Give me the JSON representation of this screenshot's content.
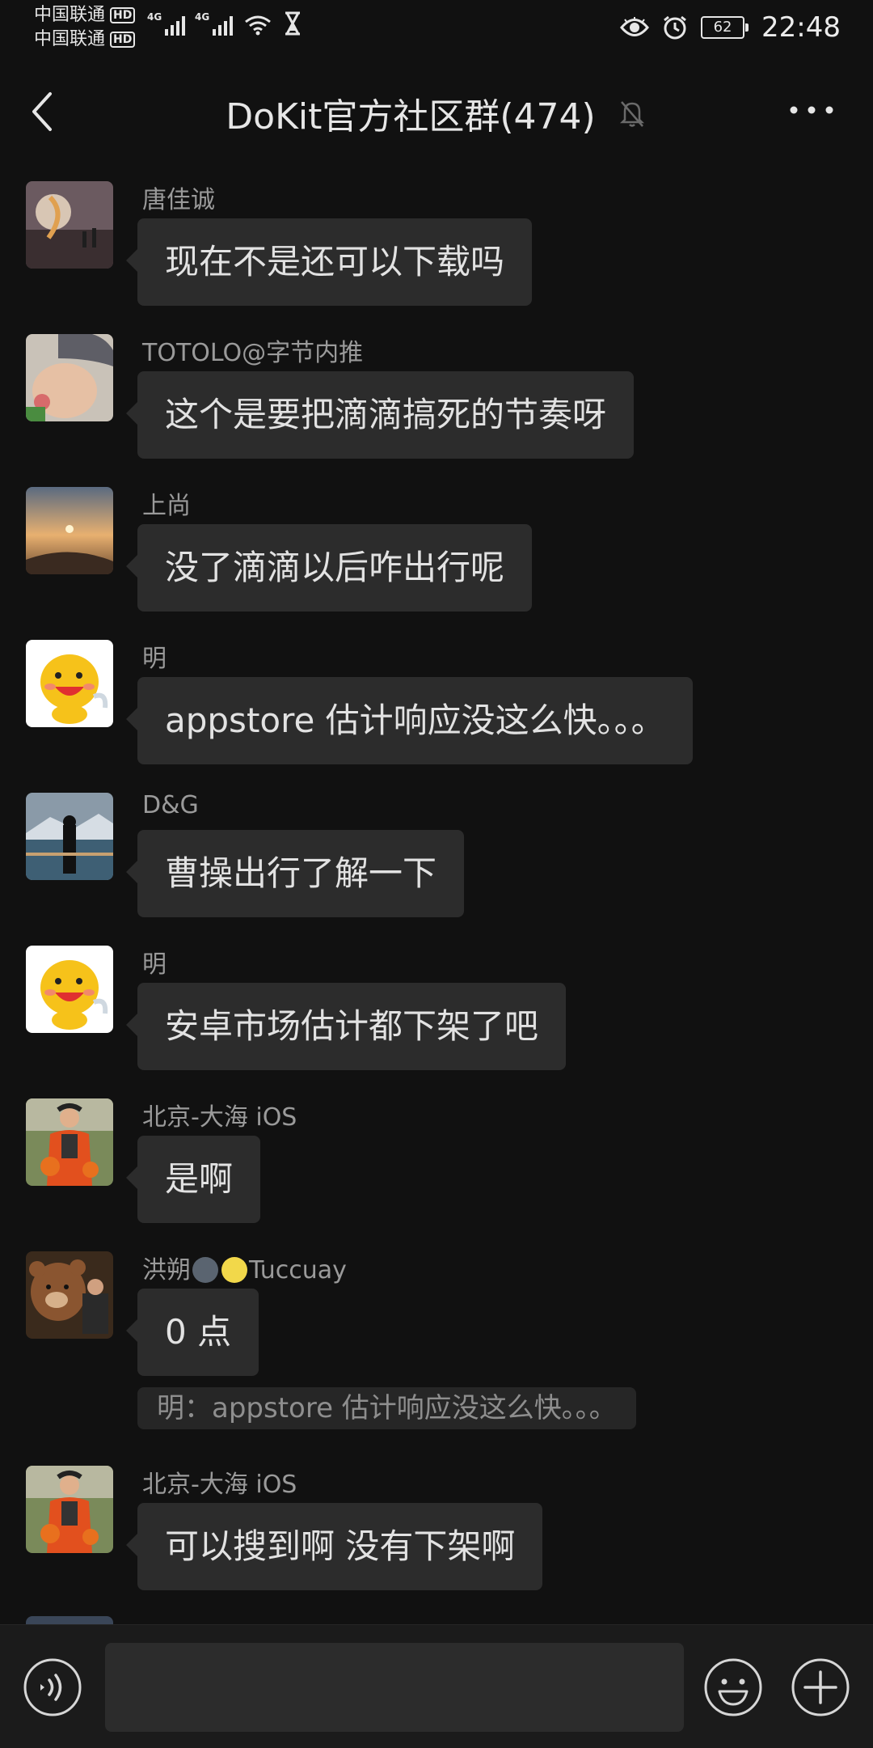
{
  "status_bar": {
    "carrier1": "中国联通",
    "carrier2": "中国联通",
    "hd": "HD",
    "network1": "4G",
    "network2": "4G",
    "battery": "62",
    "time": "22:48"
  },
  "header": {
    "back_icon": "chevron-left-icon",
    "title": "DoKit官方社区群(474)",
    "mute_icon": "bell-off-icon",
    "more_icon": "more-horizontal-icon"
  },
  "messages": [
    {
      "sender": "唐佳诚",
      "text": "现在不是还可以下载吗"
    },
    {
      "sender": "TOTOLO@字节内推",
      "text": "这个是要把滴滴搞死的节奏呀"
    },
    {
      "sender": "上尚",
      "text": "没了滴滴以后咋出行呢"
    },
    {
      "sender": "明",
      "text": "appstore 估计响应没这么快。。。"
    },
    {
      "sender": "D&G",
      "text": "曹操出行了解一下"
    },
    {
      "sender": "明",
      "text": "安卓市场估计都下架了吧"
    },
    {
      "sender": "北京-大海 iOS",
      "text": "是啊"
    },
    {
      "sender_prefix": "洪朔",
      "sender_suffix": "Tuccuay",
      "text": "0 点",
      "quote": "明：appstore 估计响应没这么快。。。"
    },
    {
      "sender": "北京-大海 iOS",
      "text": "可以搜到啊 没有下架啊"
    }
  ],
  "input_bar": {
    "voice_icon": "voice-icon",
    "message_placeholder": "",
    "emoji_icon": "emoji-icon",
    "plus_icon": "plus-icon"
  },
  "colors": {
    "background": "#111111",
    "bubble": "#2c2c2c",
    "sender_text": "#9a9a9a",
    "message_text": "#e2e2e2"
  }
}
